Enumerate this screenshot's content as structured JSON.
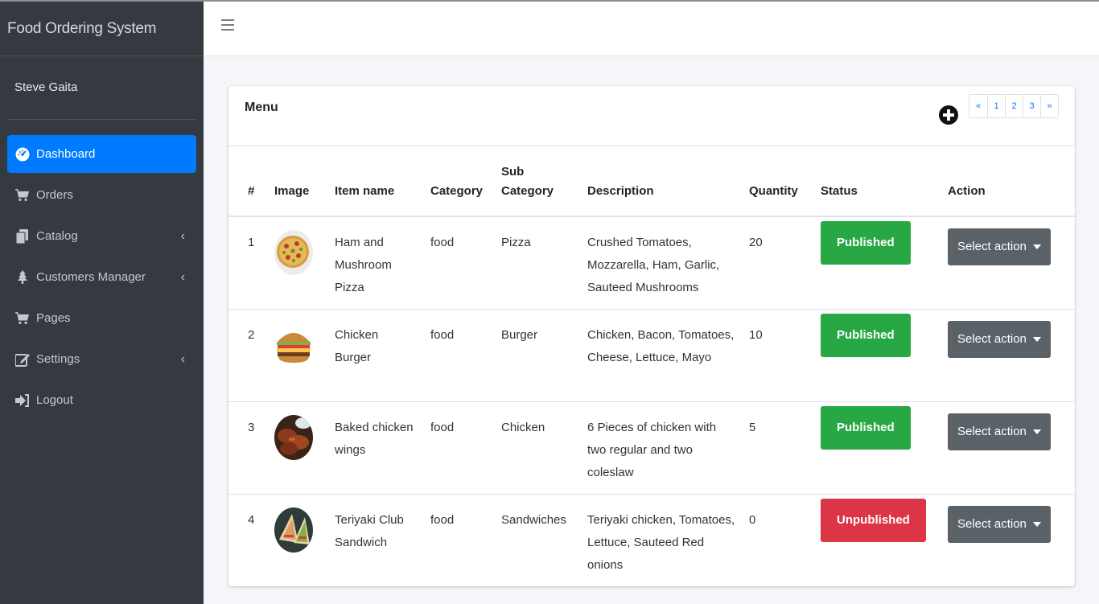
{
  "brand": {
    "title": "Food Ordering System"
  },
  "user": {
    "name": "Steve Gaita"
  },
  "sidebar": {
    "items": [
      {
        "label": "Dashboard",
        "icon": "dashboard-icon",
        "active": true
      },
      {
        "label": "Orders",
        "icon": "cart-icon"
      },
      {
        "label": "Catalog",
        "icon": "copy-icon",
        "has_submenu": true
      },
      {
        "label": "Customers Manager",
        "icon": "tree-icon",
        "has_submenu": true
      },
      {
        "label": "Pages",
        "icon": "cart-icon"
      },
      {
        "label": "Settings",
        "icon": "edit-icon",
        "has_submenu": true
      },
      {
        "label": "Logout",
        "icon": "sign-out-icon"
      }
    ],
    "chevron": "‹"
  },
  "card": {
    "title": "Menu",
    "pagination": [
      "«",
      "1",
      "2",
      "3",
      "»"
    ]
  },
  "table": {
    "headers": {
      "num": "#",
      "image": "Image",
      "item_name": "Item name",
      "category": "Category",
      "sub_category_1": "Sub",
      "sub_category_2": "Category",
      "description": "Description",
      "quantity": "Quantity",
      "status": "Status",
      "action": "Action"
    },
    "rows": [
      {
        "num": "1",
        "image": "pizza",
        "name": "Ham and Mushroom Pizza",
        "category": "food",
        "sub_category": "Pizza",
        "description": "Crushed Tomatoes, Mozzarella, Ham, Garlic, Sauteed Mushrooms",
        "quantity": "20",
        "status": "Published",
        "action": "Select action"
      },
      {
        "num": "2",
        "image": "burger",
        "name": "Chicken Burger",
        "category": "food",
        "sub_category": "Burger",
        "description": "Chicken, Bacon, Tomatoes, Cheese, Lettuce, Mayo",
        "quantity": "10",
        "status": "Published",
        "action": "Select action"
      },
      {
        "num": "3",
        "image": "chicken-wings",
        "name": "Baked chicken wings",
        "category": "food",
        "sub_category": "Chicken",
        "description": "6 Pieces of chicken with two regular and two coleslaw",
        "quantity": "5",
        "status": "Published",
        "action": "Select action"
      },
      {
        "num": "4",
        "image": "sandwich",
        "name": "Teriyaki Club Sandwich",
        "category": "food",
        "sub_category": "Sandwiches",
        "description": "Teriyaki chicken, Tomatoes, Lettuce, Sauteed Red onions",
        "quantity": "0",
        "status": "Unpublished",
        "action": "Select action"
      }
    ]
  },
  "colors": {
    "primary": "#007bff",
    "success": "#28a745",
    "danger": "#dc3545",
    "sidebar": "#343a40",
    "secondary": "#5a6268"
  }
}
